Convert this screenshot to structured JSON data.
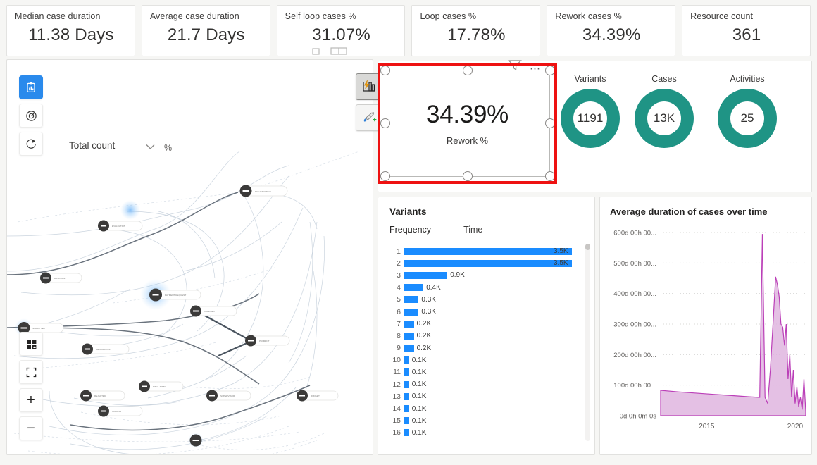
{
  "kpis": [
    {
      "title": "Median case duration",
      "value": "11.38 Days"
    },
    {
      "title": "Average case duration",
      "value": "21.7 Days"
    },
    {
      "title": "Self loop cases %",
      "value": "31.07%"
    },
    {
      "title": "Loop cases %",
      "value": "17.78%"
    },
    {
      "title": "Rework cases %",
      "value": "34.39%"
    },
    {
      "title": "Resource count",
      "value": "361"
    }
  ],
  "map_toolbar": {
    "metric_dropdown_value": "Total count",
    "percent_label": "%",
    "icons": [
      "stats-clipboard-icon",
      "target-icon",
      "refresh-icon"
    ],
    "bottom_icons": [
      "layout-grid-icon",
      "fit-to-screen-icon",
      "zoom-in-icon",
      "zoom-out-icon"
    ],
    "zoom_in_label": "+",
    "zoom_out_label": "−"
  },
  "side_tools": [
    {
      "name": "chart-lightning-icon",
      "selected": true
    },
    {
      "name": "brush-add-icon",
      "selected": false
    }
  ],
  "selected_visual": {
    "value": "34.39%",
    "label": "Rework %",
    "funnel_icon": "filter-funnel-icon",
    "more_icon": "more-options-icon",
    "highlight_color": "#ee1111"
  },
  "donuts": [
    {
      "title": "Variants",
      "value": "1191"
    },
    {
      "title": "Cases",
      "value": "13K"
    },
    {
      "title": "Activities",
      "value": "25"
    }
  ],
  "variants_panel": {
    "title": "Variants",
    "tabs": [
      {
        "label": "Frequency",
        "active": true
      },
      {
        "label": "Time",
        "active": false
      }
    ]
  },
  "duration_panel": {
    "title": "Average duration of cases over time"
  },
  "colors": {
    "donut_teal": "#1f9485",
    "bar_blue": "#1a8cff",
    "area_line": "#bb3fb8",
    "area_fill": "#ddaedd",
    "accent_blue": "#2a8aec"
  },
  "chart_data": [
    {
      "type": "bar",
      "title": "Variants",
      "orientation": "horizontal",
      "xlabel": "",
      "ylabel": "",
      "categories": [
        "1",
        "2",
        "3",
        "4",
        "5",
        "6",
        "7",
        "8",
        "9",
        "10",
        "11",
        "12",
        "13",
        "14",
        "15",
        "16"
      ],
      "values": [
        3500,
        3500,
        900,
        400,
        300,
        300,
        200,
        200,
        200,
        100,
        100,
        100,
        100,
        100,
        100,
        100
      ],
      "value_labels": [
        "3.5K",
        "3.5K",
        "0.9K",
        "0.4K",
        "0.3K",
        "0.3K",
        "0.2K",
        "0.2K",
        "0.2K",
        "0.1K",
        "0.1K",
        "0.1K",
        "0.1K",
        "0.1K",
        "0.1K",
        "0.1K"
      ],
      "grid": false,
      "legend": "none"
    },
    {
      "type": "area",
      "title": "Average duration of cases over time",
      "xlabel": "",
      "ylabel": "",
      "ytick_labels": [
        "0d 0h 0m 0s",
        "100d 00h 00...",
        "200d 00h 00...",
        "300d 00h 00...",
        "400d 00h 00...",
        "500d 00h 00...",
        "600d 00h 00..."
      ],
      "ylim": [
        0,
        600
      ],
      "xtick_labels": [
        "2015",
        "2020"
      ],
      "grid": true,
      "legend": "none",
      "x": [
        2012.4,
        2013.4,
        2014.4,
        2015.4,
        2016.4,
        2017.4,
        2018.0,
        2018.15,
        2018.3,
        2018.45,
        2018.6,
        2018.75,
        2018.9,
        2019.0,
        2019.1,
        2019.2,
        2019.3,
        2019.4,
        2019.5,
        2019.6,
        2019.7,
        2019.8,
        2019.9,
        2020.0,
        2020.1,
        2020.2,
        2020.3,
        2020.4,
        2020.5,
        2020.6
      ],
      "y": [
        83,
        78,
        74,
        70,
        66,
        62,
        60,
        595,
        60,
        40,
        150,
        300,
        455,
        430,
        390,
        300,
        290,
        230,
        300,
        120,
        200,
        60,
        150,
        40,
        95,
        30,
        60,
        20,
        120,
        15
      ]
    }
  ]
}
